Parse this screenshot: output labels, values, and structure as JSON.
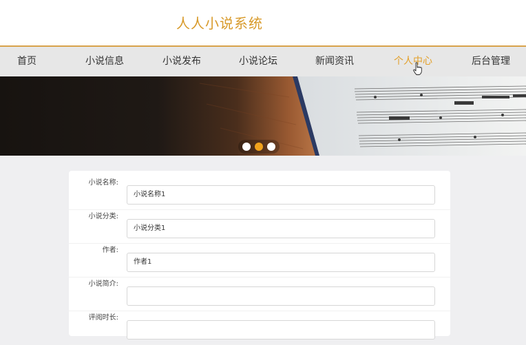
{
  "header": {
    "title": "人人小说系统"
  },
  "nav": {
    "items": [
      {
        "label": "首页"
      },
      {
        "label": "小说信息"
      },
      {
        "label": "小说发布"
      },
      {
        "label": "小说论坛"
      },
      {
        "label": "新闻资讯"
      },
      {
        "label": "个人中心"
      },
      {
        "label": "后台管理"
      }
    ],
    "active": "个人中心",
    "accent_color": "#e3a02a"
  },
  "banner": {
    "image": "sheet-music-on-wooden-table",
    "slide_count": 3,
    "active_slide": 2
  },
  "form": {
    "fields": [
      {
        "label": "小说名称:",
        "value": "小说名称1"
      },
      {
        "label": "小说分类:",
        "value": "小说分类1"
      },
      {
        "label": "作者:",
        "value": "作者1"
      },
      {
        "label": "小说简介:",
        "value": ""
      },
      {
        "label": "评阅时长:",
        "value": ""
      }
    ]
  }
}
